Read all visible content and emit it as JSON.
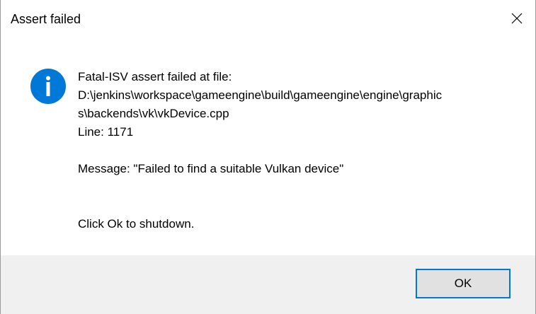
{
  "window": {
    "title": "Assert failed",
    "close_icon": "close-icon"
  },
  "content": {
    "icon": "info-icon",
    "lines": [
      "Fatal-ISV assert failed at file:",
      "D:\\jenkins\\workspace\\gameengine\\build\\gameengine\\engine\\graphic",
      "s\\backends\\vk\\vkDevice.cpp",
      "Line: 1171"
    ],
    "message": "Message: \"Failed to find a suitable Vulkan device\"",
    "instruction": "Click Ok to shutdown."
  },
  "footer": {
    "ok_label": "OK"
  },
  "colors": {
    "info_blue": "#0078d7",
    "footer_bg": "#f0f0f0",
    "button_bg": "#e1e1e1",
    "button_border": "#0078d7"
  }
}
